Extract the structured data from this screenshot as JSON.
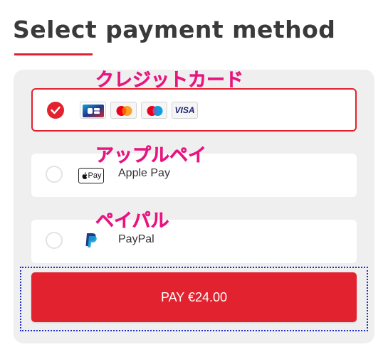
{
  "page": {
    "title": "Select payment method"
  },
  "annotations": {
    "card": "クレジットカード",
    "apple": "アップルペイ",
    "paypal": "ペイパル"
  },
  "options": [
    {
      "id": "card",
      "label": "",
      "selected": true,
      "icons": [
        "cb-card-icon",
        "mastercard-icon",
        "maestro-icon",
        "visa-icon"
      ],
      "visa_text": "VISA"
    },
    {
      "id": "apple-pay",
      "label": "Apple Pay",
      "selected": false,
      "logo_text": "Pay"
    },
    {
      "id": "paypal",
      "label": "PayPal",
      "selected": false
    }
  ],
  "pay_button": {
    "label": "PAY €24.00"
  },
  "colors": {
    "accent": "#e2222f",
    "annotation": "#e8157f",
    "highlight_border": "#1d2ed0",
    "panel_bg": "#efefef"
  }
}
